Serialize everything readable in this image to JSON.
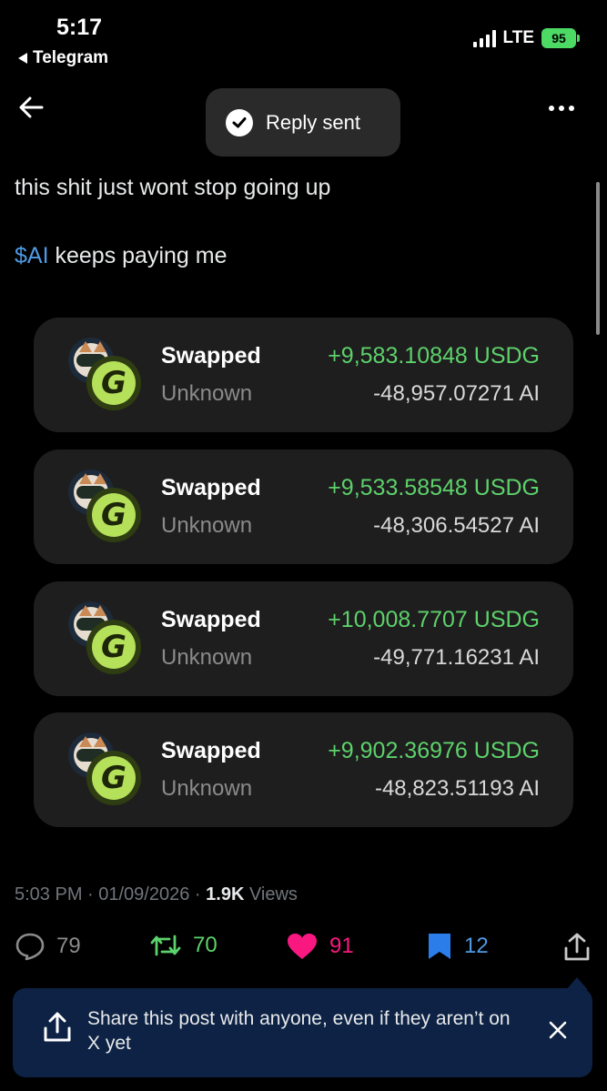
{
  "status_bar": {
    "time": "5:17",
    "back_app": "Telegram",
    "network": "LTE",
    "battery": "95"
  },
  "toast": {
    "text": "Reply sent"
  },
  "post": {
    "line1": "this shit just wont stop going up",
    "cashtag": "$AI",
    "line2_rest": " keeps paying me",
    "timestamp": "5:03 PM · 01/09/2026 · ",
    "views_count": "1.9K",
    "views_label": " Views"
  },
  "swaps": [
    {
      "title": "Swapped",
      "subtitle": "Unknown",
      "amount_in": "+9,583.10848 USDG",
      "amount_out": "-48,957.07271 AI"
    },
    {
      "title": "Swapped",
      "subtitle": "Unknown",
      "amount_in": "+9,533.58548 USDG",
      "amount_out": "-48,306.54527 AI"
    },
    {
      "title": "Swapped",
      "subtitle": "Unknown",
      "amount_in": "+10,008.7707 USDG",
      "amount_out": "-49,771.16231 AI"
    },
    {
      "title": "Swapped",
      "subtitle": "Unknown",
      "amount_in": "+9,902.36976 USDG",
      "amount_out": "-48,823.51193 AI"
    }
  ],
  "actions": {
    "replies": "79",
    "reposts": "70",
    "likes": "91",
    "bookmarks": "12"
  },
  "share_banner": {
    "text": "Share this post with anyone, even if they aren’t on X yet"
  },
  "colors": {
    "accent_blue": "#4f9ae5",
    "green": "#5dd16b",
    "pink": "#f91880",
    "banner_bg": "#0d2244"
  },
  "icons": [
    "back-arrow-icon",
    "more-icon",
    "check-icon",
    "reply-icon",
    "repost-icon",
    "like-icon",
    "bookmark-icon",
    "share-icon",
    "close-icon"
  ]
}
